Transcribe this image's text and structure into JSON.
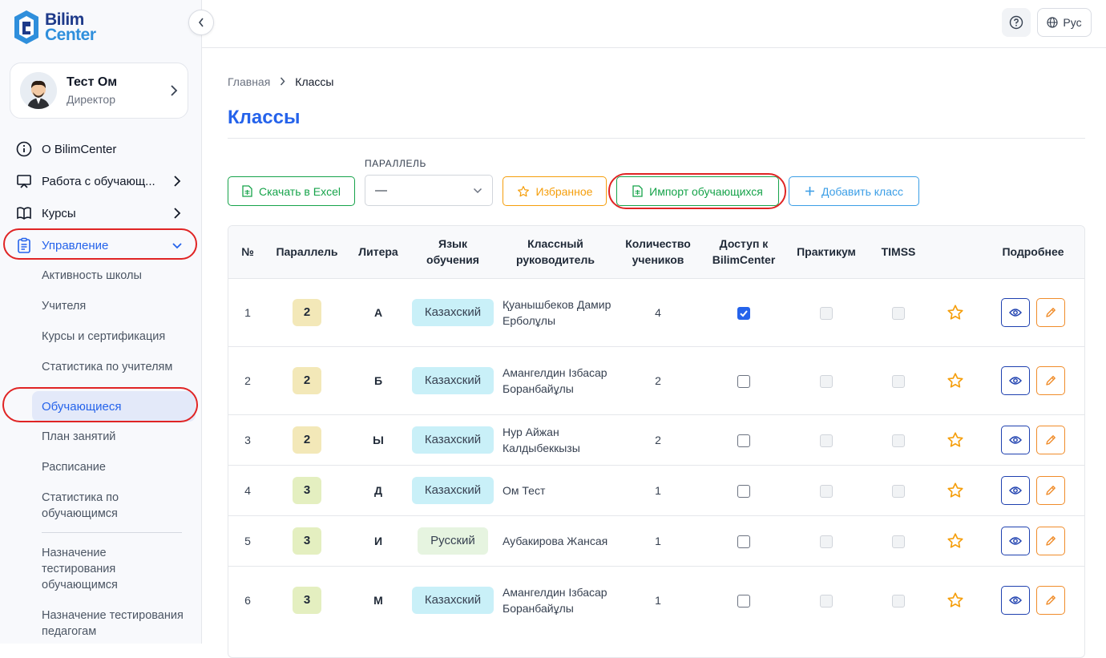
{
  "brand": {
    "line1": "Bilim",
    "line2": "Center"
  },
  "profile": {
    "name": "Тест Ом",
    "role": "Директор"
  },
  "nav": {
    "items": [
      {
        "label": "О BilimCenter"
      },
      {
        "label": "Работа с обучающ..."
      },
      {
        "label": "Курсы"
      },
      {
        "label": "Управление"
      }
    ],
    "sub": [
      "Активность школы",
      "Учителя",
      "Курсы и сертификация",
      "Статистика по учителям",
      "Обучающиеся",
      "План занятий",
      "Расписание",
      "Статистика по обучающимся",
      "Назначение тестирования обучающимся",
      "Назначение тестирования педагогам"
    ]
  },
  "topbar": {
    "lang": "Рус"
  },
  "breadcrumb": {
    "home": "Главная",
    "current": "Классы"
  },
  "page": {
    "title": "Классы"
  },
  "toolbar": {
    "excel": "Скачать в Excel",
    "filter_label": "ПАРАЛЛЕЛЬ",
    "filter_value": "—",
    "favorites": "Избранное",
    "import": "Импорт обучающихся",
    "add": "Добавить класс"
  },
  "table": {
    "headers": [
      "№",
      "Параллель",
      "Литера",
      "Язык обучения",
      "Классный руководитель",
      "Количество учеников",
      "Доступ к BilimCenter",
      "Практикум",
      "TIMSS",
      "",
      "Подробнее"
    ],
    "rows": [
      {
        "n": "1",
        "par": "2",
        "lit": "А",
        "lang": "Казахский",
        "teacher": "Қуанышбеков Дамир Ерболұлы",
        "count": "4",
        "access": true
      },
      {
        "n": "2",
        "par": "2",
        "lit": "Б",
        "lang": "Казахский",
        "teacher": "Амангелдин Ізбасар Боранбайұлы",
        "count": "2",
        "access": false
      },
      {
        "n": "3",
        "par": "2",
        "lit": "Ы",
        "lang": "Казахский",
        "teacher": "Нур Айжан Калдыбеккызы",
        "count": "2",
        "access": false
      },
      {
        "n": "4",
        "par": "3",
        "lit": "Д",
        "lang": "Казахский",
        "teacher": "Ом Тест",
        "count": "1",
        "access": false
      },
      {
        "n": "5",
        "par": "3",
        "lit": "И",
        "lang": "Русский",
        "teacher": "Аубакирова Жансая",
        "count": "1",
        "access": false
      },
      {
        "n": "6",
        "par": "3",
        "lit": "М",
        "lang": "Казахский",
        "teacher": "Амангелдин Ізбасар Боранбайұлы",
        "count": "1",
        "access": false
      }
    ]
  },
  "colors": {
    "accent": "#2563eb",
    "green": "#16a34a",
    "orange": "#f08c2a",
    "yellow": "#f59e0b",
    "par2": "#f3e8b8",
    "par3": "#e4efc0",
    "kaz": "#c9f0f8",
    "rus": "#e6f4e0",
    "highlight": "#e02424"
  }
}
